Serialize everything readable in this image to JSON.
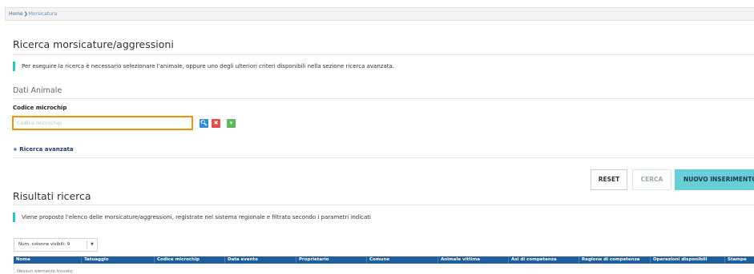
{
  "breadcrumb": {
    "home": "Home",
    "separator": "❯",
    "current": "Morsicatura"
  },
  "page": {
    "title": "Ricerca morsicature/aggressioni",
    "info": "Per eseguire la ricerca è necessario selezionare l'animale, oppure uno degli ulteriori criteri disponibili nella sezione ricerca avanzata."
  },
  "animal": {
    "title": "Dati Animale",
    "microchip_label": "Codice microchip",
    "microchip_value": "",
    "microchip_placeholder": "Codice microchip",
    "search_glyph": "🔍︎",
    "clear_glyph": "✖",
    "add_glyph": "▾"
  },
  "advanced_link": "+ Ricerca avanzata",
  "actions": {
    "reset": "RESET",
    "search": "CERCA",
    "new": "NUOVO INSERIMENTO"
  },
  "results": {
    "title": "Risultati ricerca",
    "info": "Viene proposto l'elenco delle morsicature/aggressioni, registrate nel sistema regionale e filtrato secondo i parametri indicati",
    "visible_columns_label": "Num. colonne visibili: 9",
    "columns": [
      "Nome",
      "Tatuaggio",
      "Codice microchip",
      "Data evento",
      "Proprietario",
      "Comune",
      "Animale vittima",
      "Asl di competenza",
      "Regione di competenza",
      "Operazioni disponibili",
      "Stampe"
    ],
    "empty_message": "Nessun elemento trovato"
  },
  "colors": {
    "accent": "#2ec4b6",
    "focus_border": "#f0940b",
    "table_header": "#1f5d9c",
    "new_button": "#68cfd8"
  }
}
